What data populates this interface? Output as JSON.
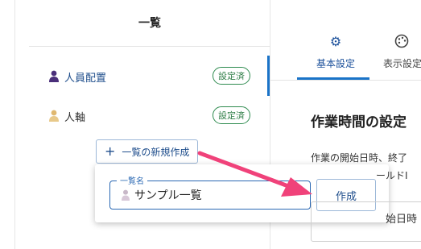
{
  "left_panel": {
    "title": "一覧",
    "items": [
      {
        "label": "人員配置",
        "badge": "設定済",
        "active": true
      },
      {
        "label": "人軸",
        "badge": "設定済",
        "active": false
      }
    ],
    "add_button_label": "一覧の新規作成"
  },
  "popover": {
    "field_legend": "一覧名",
    "field_value": "サンプル一覧",
    "create_button_label": "作成"
  },
  "right_panel": {
    "tabs": [
      {
        "label": "基本設定",
        "icon": "gear-icon",
        "active": true
      },
      {
        "label": "表示設定",
        "icon": "palette-icon",
        "active": false
      }
    ],
    "section_title": "作業時間の設定",
    "description_line1": "作業の開始日時、終了",
    "description_line2": "ールドI",
    "field_label": "始日時"
  },
  "colors": {
    "accent": "#1a73c8",
    "badge_green": "#2e7d46",
    "arrow_pink": "#f0427a"
  }
}
